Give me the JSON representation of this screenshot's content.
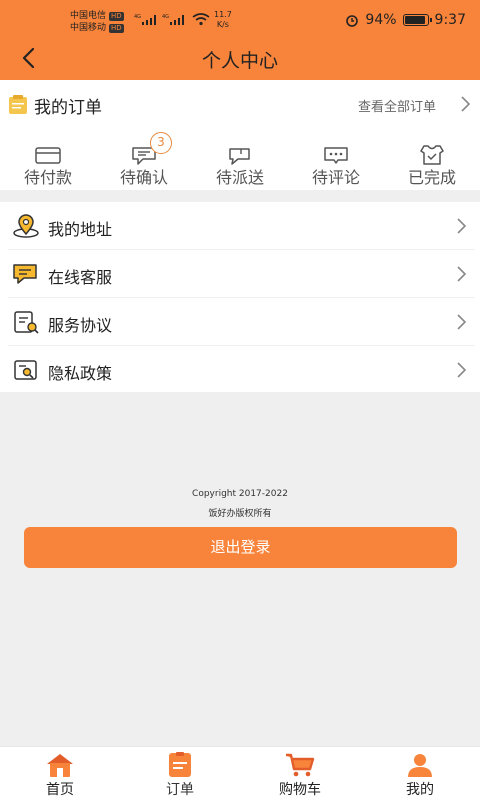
{
  "status_bar": {
    "carrier1": "中国电信",
    "carrier2": "中国移动",
    "hd": "HD",
    "net_speed_value": "11.7",
    "net_speed_unit": "K/s",
    "battery": "94%",
    "time": "9:37"
  },
  "header": {
    "title": "个人中心"
  },
  "orders": {
    "title": "我的订单",
    "view_all": "查看全部订单",
    "statuses": [
      {
        "label": "待付款",
        "icon": "wallet-icon"
      },
      {
        "label": "待确认",
        "icon": "chat-icon",
        "badge": "3"
      },
      {
        "label": "待派送",
        "icon": "delivery-icon"
      },
      {
        "label": "待评论",
        "icon": "comment-icon"
      },
      {
        "label": "已完成",
        "icon": "check-shirt-icon"
      }
    ]
  },
  "menu": [
    {
      "label": "我的地址",
      "icon": "location-icon"
    },
    {
      "label": "在线客服",
      "icon": "chat-bubble-icon"
    },
    {
      "label": "服务协议",
      "icon": "document-icon"
    },
    {
      "label": "隐私政策",
      "icon": "privacy-icon"
    }
  ],
  "footer": {
    "copyright": "Copyright 2017-2022",
    "owner": "饭好办版权所有",
    "logout": "退出登录"
  },
  "tabbar": [
    {
      "label": "首页",
      "icon": "home-icon"
    },
    {
      "label": "订单",
      "icon": "order-icon"
    },
    {
      "label": "购物车",
      "icon": "cart-icon"
    },
    {
      "label": "我的",
      "icon": "user-icon"
    }
  ],
  "colors": {
    "accent": "#f7843a",
    "icon_yellow": "#f5b82e"
  }
}
